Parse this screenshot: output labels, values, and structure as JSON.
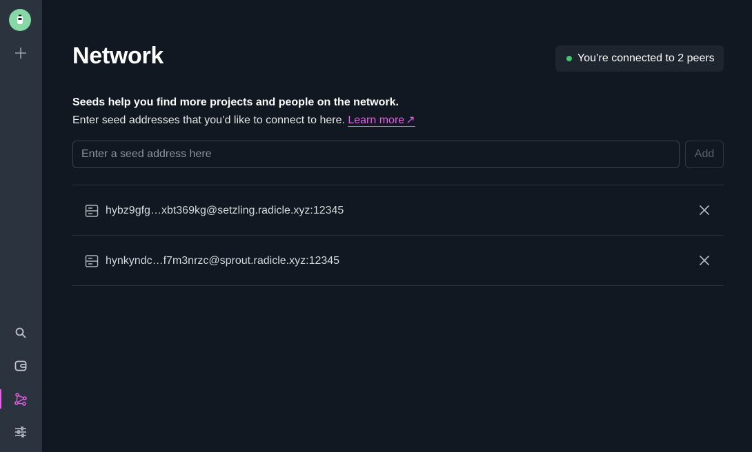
{
  "page": {
    "title": "Network"
  },
  "status": {
    "peers_text": "You’re connected to 2 peers"
  },
  "description": {
    "strong": "Seeds help you find more projects and people on the network.",
    "text": "Enter seed addresses that you’d like to connect to here. ",
    "link_label": "Learn more",
    "link_arrow": "↗"
  },
  "seed_form": {
    "placeholder": "Enter a seed address here",
    "value": "",
    "add_label": "Add"
  },
  "seeds": [
    {
      "address": "hybz9gfg…xbt369kg@setzling.radicle.xyz:12345"
    },
    {
      "address": "hynkyndc…f7m3nrzc@sprout.radicle.xyz:12345"
    }
  ],
  "sidebar": {
    "items": [
      {
        "icon": "search-icon"
      },
      {
        "icon": "wallet-icon"
      },
      {
        "icon": "network-icon",
        "active": true
      },
      {
        "icon": "settings-sliders-icon"
      }
    ]
  },
  "colors": {
    "background": "#111821",
    "sidebar": "#2b333f",
    "accent": "#e35fe4",
    "online": "#3bc96e",
    "avatar": "#86d9a6"
  }
}
